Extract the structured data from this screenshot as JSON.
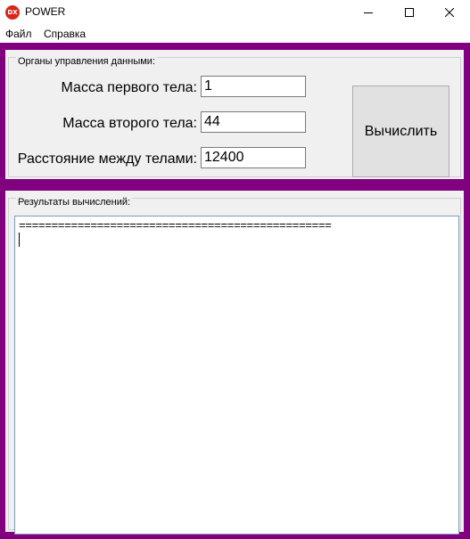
{
  "window": {
    "icon_text": "DX",
    "title": "POWER",
    "icon_color": "#d9261c",
    "frame_color": "#800080"
  },
  "menu": {
    "items": [
      {
        "label": "Файл"
      },
      {
        "label": "Справка"
      }
    ]
  },
  "controls": {
    "group_title": "Органы управления данными:",
    "fields": [
      {
        "label": "Масса первого тела:",
        "value": "1"
      },
      {
        "label": "Масса второго тела:",
        "value": "44"
      },
      {
        "label": "Расстояние между телами:",
        "value": "12400"
      }
    ],
    "calculate_label": "Вычислить"
  },
  "results": {
    "group_title": "Результаты вычислений:",
    "text": "================================================"
  }
}
